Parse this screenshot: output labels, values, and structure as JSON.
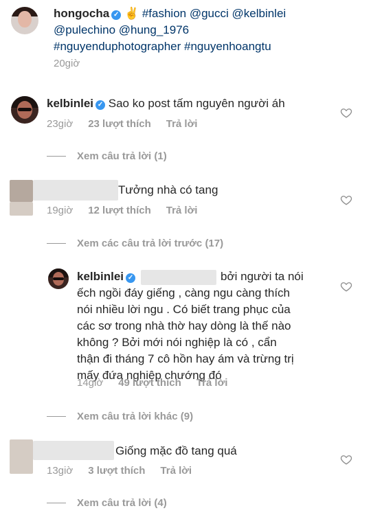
{
  "post": {
    "username": "hongocha",
    "caption_line1": "✌ #fashion @gucci @kelbinlei",
    "caption_line2": "@pulechino @hung_1976",
    "caption_line3": "#nguyenduphotographer #nguyenhoangtu",
    "time": "20giờ"
  },
  "comments": [
    {
      "username": "kelbinlei",
      "text": "Sao ko post tấm nguyên người áh",
      "time": "23giờ",
      "likes": "23 lượt thích",
      "reply_label": "Trả lời",
      "view_replies": "Xem câu trả lời (1)"
    },
    {
      "username": "",
      "text": "Tưởng nhà có tang",
      "time": "19giờ",
      "likes": "12 lượt thích",
      "reply_label": "Trả lời",
      "view_replies": "Xem các câu trả lời trước (17)"
    },
    {
      "username": "kelbinlei",
      "text_line1": "bởi người ta nói",
      "text_line2": "ếch ngồi đáy giếng , càng ngu càng thích",
      "text_line3": "nói nhiều lời ngu . Có biết trang phục của",
      "text_line4": "các sơ trong nhà thờ hay dòng là thế nào",
      "text_line5": "không ? Bởi mới nói nghiệp là có , cẩn",
      "text_line6": "thận đi tháng 7 cô hồn hay ám và trừng trị",
      "text_line7": "mấy đứa nghiệp chướng đó",
      "time": "14giờ",
      "likes": "49 lượt thích",
      "reply_label": "Trả lời",
      "view_replies": "Xem câu trả lời khác (9)"
    },
    {
      "username": "",
      "text": "Giống mặc đồ tang quá",
      "time": "13giờ",
      "likes": "3 lượt thích",
      "reply_label": "Trả lời",
      "view_replies": "Xem câu trả lời (4)"
    }
  ],
  "colors": {
    "text": "#262626",
    "muted": "#999999",
    "link": "#003569",
    "verified": "#3897f0"
  }
}
